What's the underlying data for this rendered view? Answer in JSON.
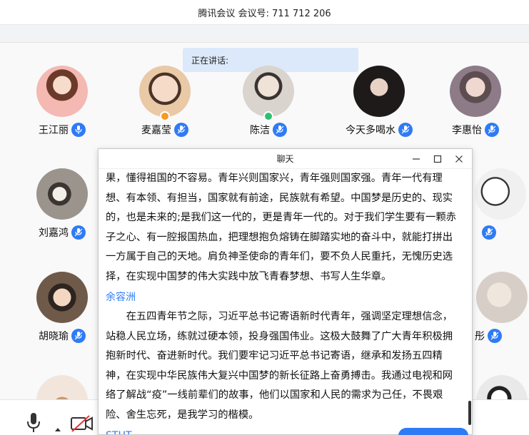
{
  "window": {
    "title": "腾讯会议 会议号: 711 712 206"
  },
  "speaking": {
    "label": "正在讲话:"
  },
  "participants_row1": [
    {
      "name": "王江丽",
      "color": "#f3b9b2"
    },
    {
      "name": "麦嘉莹",
      "color": "#e9c9a6",
      "badge": "#f59a23"
    },
    {
      "name": "陈洁",
      "color": "#d9d4cd",
      "badge": "#2fbf71"
    },
    {
      "name": "今天多喝水",
      "color": "#2b2625"
    },
    {
      "name": "李惠怡",
      "color": "#8d7c88"
    }
  ],
  "participants_left": [
    {
      "name": "刘嘉鸿",
      "color": "#9b948c"
    },
    {
      "name": "胡晓瑜",
      "color": "#6f5a4a"
    }
  ],
  "participants_right_partial": [
    {
      "name": "彤",
      "color": "#d7cfc7"
    }
  ],
  "chat": {
    "title": "聊天",
    "messages": [
      {
        "sender": "",
        "text": "果，懂得祖国的不容易。青年兴则国家兴，青年强则国家强。青年一代有理想、有本领、有担当，国家就有前途，民族就有希望。中国梦是历史的、现实的，也是未来的;是我们这一代的，更是青年一代的。对于我们学生要有一颗赤子之心、有一腔报国热血，把理想抱负熔铸在脚踏实地的奋斗中，就能打拼出一方属于自己的天地。肩负神圣使命的青年们，要不负人民重托，无愧历史选择，在实现中国梦的伟大实践中放飞青春梦想、书写人生华章。"
      },
      {
        "sender": "余容洲",
        "text": "在五四青年节之际，习近平总书记寄语新时代青年，强调坚定理想信念，站稳人民立场，练就过硬本领，投身强国伟业。这极大鼓舞了广大青年积极拥抱新时代、奋进新时代。我们要牢记习近平总书记寄语，继承和发扬五四精神，在实现中华民族伟大复兴中国梦的新长征路上奋勇搏击。我通过电视和网络了解战“疫”一线前辈们的故事，他们以国家和人民的需求为己任，不畏艰险、舍生忘死，是我学习的楷模。"
      },
      {
        "sender": "STHT",
        "text": ""
      }
    ]
  },
  "bottom": {
    "mic_icon": "microphone-icon",
    "camera_icon": "camera-off-icon"
  },
  "colors": {
    "accent": "#2f7bf5",
    "speaking_bg": "#dce9fa"
  }
}
